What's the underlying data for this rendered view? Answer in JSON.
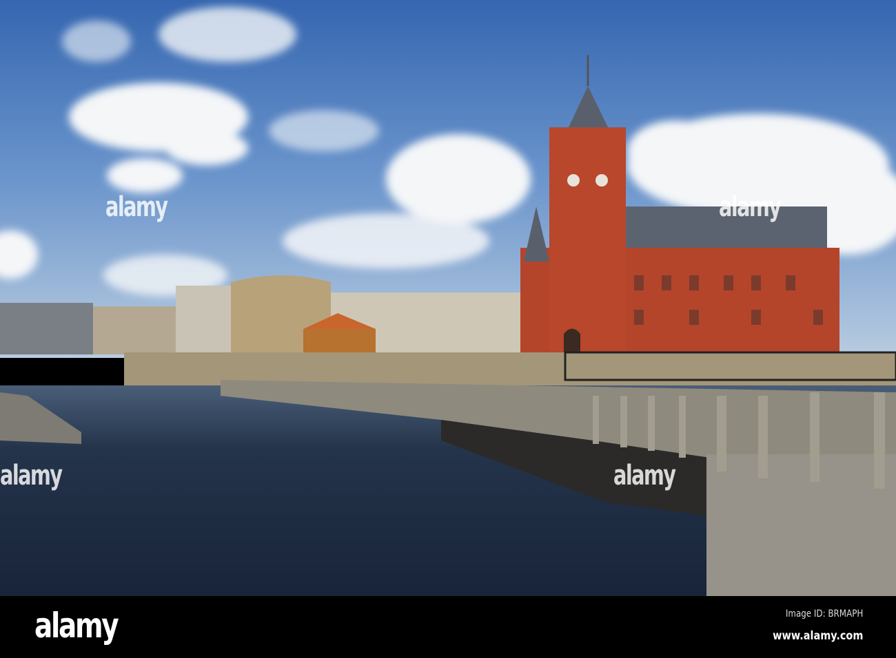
{
  "photo": {
    "subject": "Pierhead building and Cardiff Bay waterfront",
    "watermark_text": "alamy",
    "colors": {
      "sky": "#3f73b8",
      "brick": "#b4452b",
      "water": "#1d2a3c",
      "wood": "#8f8a7e"
    }
  },
  "footer": {
    "logo": "alamy",
    "image_id": "Image ID: BRMAPH",
    "website": "www.alamy.com"
  }
}
